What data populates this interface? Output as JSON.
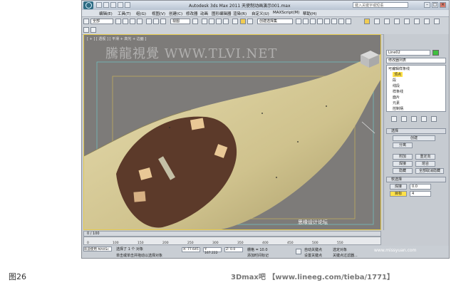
{
  "window": {
    "title": "Autodesk 3ds Max 2011    天使制动画演示001.max",
    "search_placeholder": "键入关键字或短语"
  },
  "menu": {
    "items": [
      "编辑(E)",
      "工具(T)",
      "组(G)",
      "视图(V)",
      "创建(C)",
      "修改器",
      "动画",
      "图形编辑器",
      "渲染(R)",
      "自定义(U)",
      "MAXScript(M)",
      "帮助(H)"
    ]
  },
  "toolbar": {
    "selection_filter": "全部",
    "ref_coord": "视图",
    "selection_set": "创建选择集"
  },
  "viewport": {
    "label": "[ + ] [ 透视 ] [ 平滑 + 高光 + 边面 ]",
    "watermark": "騰龍視覺 WWW.TLVI.NET"
  },
  "panel": {
    "object_name": "Line02",
    "modifier_list": "修改器列表",
    "stack": [
      "可编辑样条线",
      "顶点",
      "段",
      "线段",
      "样条线",
      "面片",
      "元素",
      "控制柄"
    ],
    "buttons": {
      "create": "创建",
      "detach": "分离",
      "attach": "附加",
      "reorient": "重定向",
      "join": "焊接",
      "hide": "隐藏",
      "unhide_all": "全部取消隐藏",
      "weld": "焊接",
      "fuse": "熔合",
      "target": "目标"
    },
    "soft_selection": "软选择",
    "selection_rollout": "选择",
    "weld_value": "0.0",
    "target_value": "4"
  },
  "timeline": {
    "frame": "0 / 100",
    "ticks": [
      "0",
      "100",
      "150",
      "200",
      "250",
      "300",
      "350",
      "400",
      "450",
      "500",
      "550"
    ]
  },
  "status": {
    "welcome": "欢迎使用 MAXSc",
    "selected": "选择了 1 个 对象",
    "prompt": "单击或单击并拖动以选择对象",
    "x": "X: 77.645",
    "y": "Y: 167.222",
    "z": "Z: 0.0",
    "grid": "栅格 = 10.0",
    "add_time_tag": "添加时间标记",
    "auto_key": "自动关键点",
    "selected_obj": "选定对象",
    "set_key": "设置关键点",
    "key_filters": "关键点过滤器..."
  },
  "overlay": {
    "forum": "思缘设计论坛",
    "site": "www.missyuan.com"
  },
  "caption": "图26",
  "footer": "3Dmax吧 【www.lineeg.com/tieba/1771】"
}
